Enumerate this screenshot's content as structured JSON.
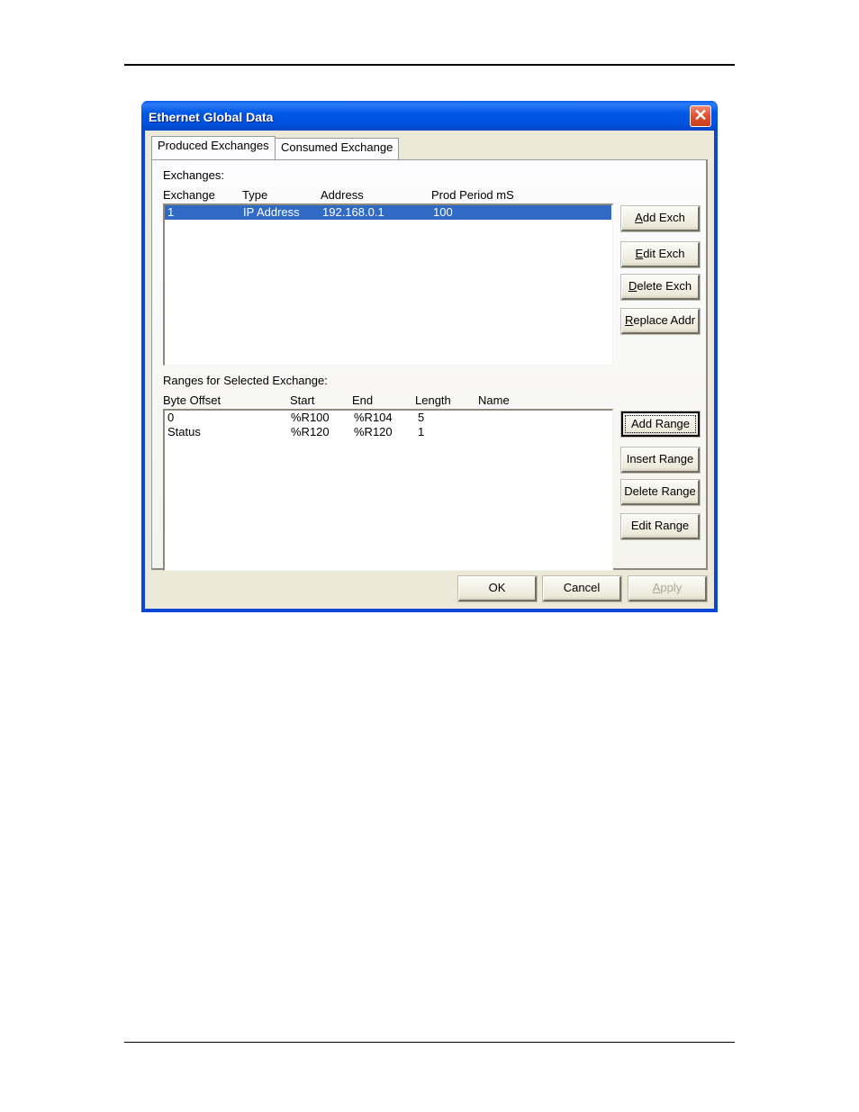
{
  "dialog": {
    "title": "Ethernet Global Data",
    "close_icon": "close-icon",
    "tabs": [
      {
        "label": "Produced Exchanges",
        "active": true
      },
      {
        "label": "Consumed Exchange",
        "active": false
      }
    ],
    "exchanges": {
      "section_label": "Exchanges:",
      "columns": [
        "Exchange",
        "Type",
        "Address",
        "Prod Period mS"
      ],
      "rows": [
        {
          "exchange": "1",
          "type": "IP Address",
          "address": "192.168.0.1",
          "prod_period": "100",
          "selected": true
        }
      ],
      "buttons": [
        {
          "mnemonic": "A",
          "rest": "dd Exch"
        },
        {
          "mnemonic": "E",
          "rest": "dit Exch"
        },
        {
          "mnemonic": "D",
          "rest": "elete Exch"
        },
        {
          "mnemonic": "R",
          "rest": "eplace Addr"
        }
      ]
    },
    "ranges": {
      "section_label": "Ranges for Selected Exchange:",
      "columns": [
        "Byte Offset",
        "Start",
        "End",
        "Length",
        "Name"
      ],
      "rows": [
        {
          "offset": "0",
          "start": "%R100",
          "end": "%R104",
          "length": "5",
          "name": ""
        },
        {
          "offset": "Status",
          "start": "%R120",
          "end": "%R120",
          "length": "1",
          "name": ""
        }
      ],
      "buttons": [
        {
          "label": "Add Range",
          "default": true
        },
        {
          "label": "Insert Range"
        },
        {
          "label": "Delete Range"
        },
        {
          "label": "Edit Range"
        }
      ]
    },
    "footer": {
      "ok": "OK",
      "cancel": "Cancel",
      "apply_mnemonic": "A",
      "apply_rest": "pply",
      "apply_disabled": true
    }
  }
}
